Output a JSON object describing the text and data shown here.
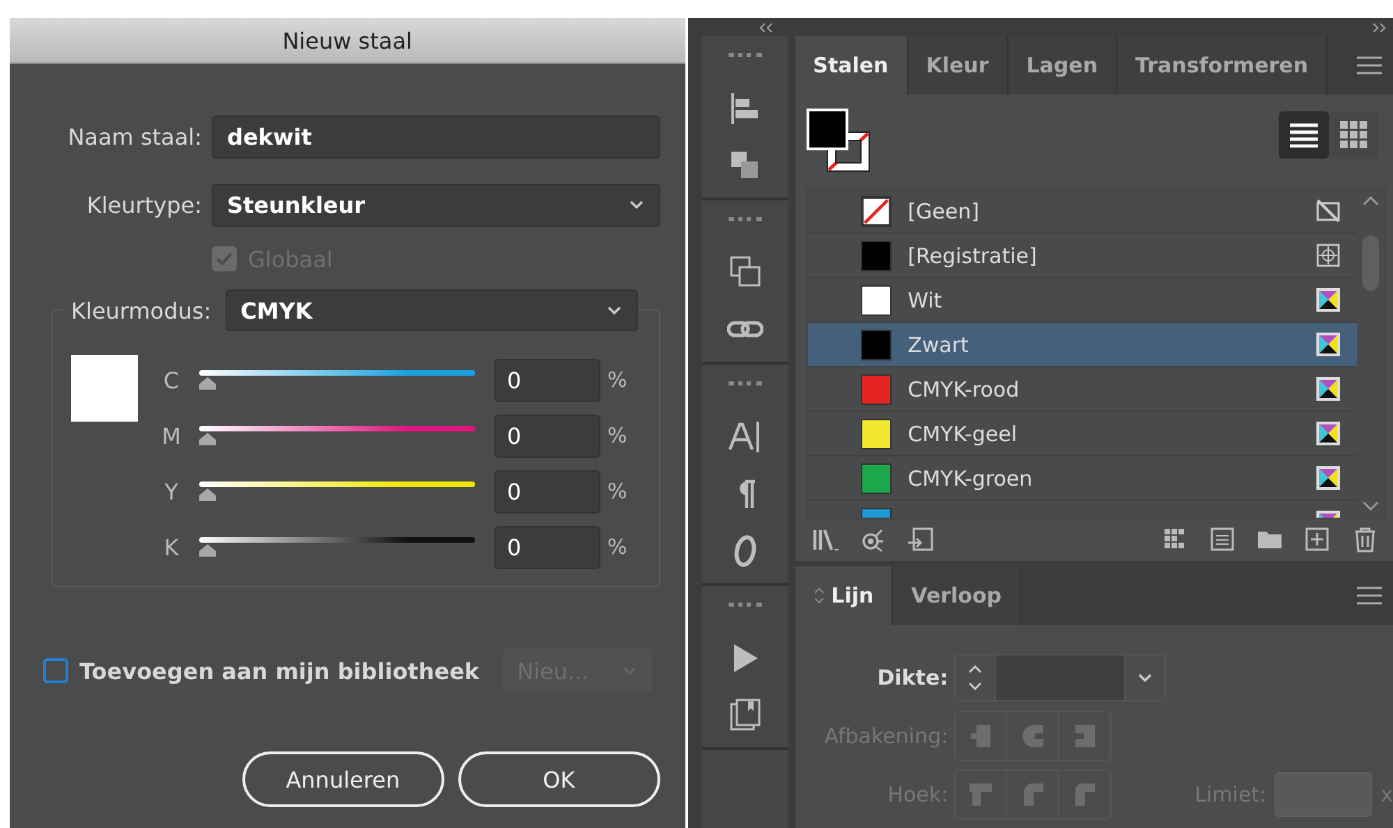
{
  "dialog": {
    "title": "Nieuw staal",
    "name_field": {
      "label": "Naam staal:",
      "value": "dekwit"
    },
    "color_type": {
      "label": "Kleurtype:",
      "value": "Steunkleur"
    },
    "global": {
      "label": "Globaal",
      "checked": true,
      "disabled": true
    },
    "color_mode": {
      "label": "Kleurmodus:",
      "value": "CMYK"
    },
    "channels": [
      {
        "name": "C",
        "level": 0,
        "value": "0",
        "unit": "%",
        "color": "#1aa3e0"
      },
      {
        "name": "M",
        "level": 0,
        "value": "0",
        "unit": "%",
        "color": "#e3157f"
      },
      {
        "name": "Y",
        "level": 0,
        "value": "0",
        "unit": "%",
        "color": "#f2e600"
      },
      {
        "name": "K",
        "level": 0,
        "value": "0",
        "unit": "%",
        "color": "#111111"
      }
    ],
    "library": {
      "label": "Toevoegen aan mijn bibliotheek",
      "checked": false,
      "dropdown": "Nieu...",
      "dropdown_disabled": true
    },
    "buttons": [
      "Annuleren",
      "OK"
    ]
  },
  "swatches_panel": {
    "tabs": [
      {
        "label": "Stalen",
        "selected": true
      },
      {
        "label": "Kleur",
        "selected": false
      },
      {
        "label": "Lagen",
        "selected": false
      },
      {
        "label": "Transformeren",
        "selected": false
      }
    ],
    "swatches": [
      {
        "name": "[Geen]",
        "kind": "none",
        "color": "#ffffff",
        "selected": false
      },
      {
        "name": "[Registratie]",
        "kind": "registration",
        "color": "#000000",
        "selected": false
      },
      {
        "name": "Wit",
        "kind": "process",
        "color": "#ffffff",
        "selected": false
      },
      {
        "name": "Zwart",
        "kind": "process",
        "color": "#000000",
        "selected": true
      },
      {
        "name": "CMYK-rood",
        "kind": "process",
        "color": "#e52521",
        "selected": false
      },
      {
        "name": "CMYK-geel",
        "kind": "process",
        "color": "#f2e830",
        "selected": false
      },
      {
        "name": "CMYK-groen",
        "kind": "process",
        "color": "#1aa84a",
        "selected": false
      },
      {
        "kind": "process",
        "color": "#1e9bd7",
        "selected": false
      }
    ]
  },
  "stroke_panel": {
    "tabs": [
      {
        "label": "Lijn",
        "selected": true
      },
      {
        "label": "Verloop",
        "selected": false
      }
    ],
    "weight": {
      "label": "Dikte:",
      "disabled": false
    },
    "cap": {
      "label": "Afbakening:",
      "disabled": true
    },
    "join": {
      "label": "Hoek:",
      "disabled": true
    },
    "limit": {
      "label": "Limiet:",
      "unit": "x",
      "disabled": true
    }
  }
}
